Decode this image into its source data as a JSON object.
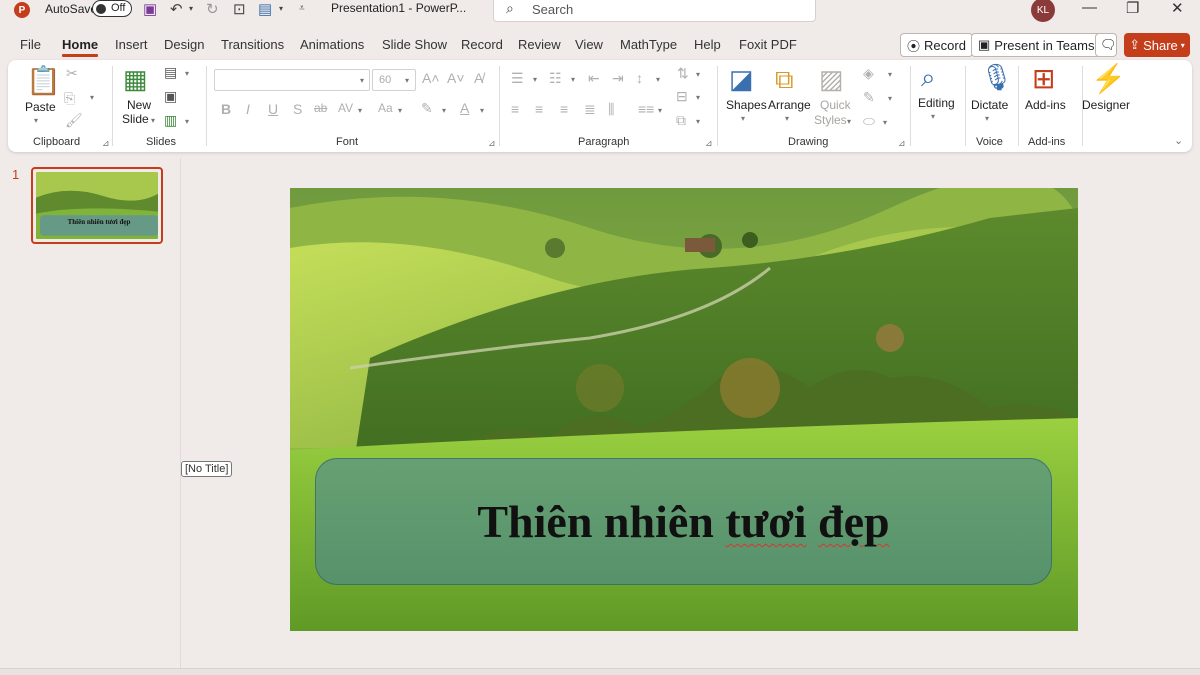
{
  "titlebar": {
    "app_letter": "P",
    "autosave_label": "AutoSave",
    "autosave_state": "Off",
    "doc_title": "Presentation1  -  PowerP...",
    "search_placeholder": "Search",
    "avatar_initials": "KL"
  },
  "menu": {
    "tabs": [
      "File",
      "Home",
      "Insert",
      "Design",
      "Transitions",
      "Animations",
      "Slide Show",
      "Record",
      "Review",
      "View",
      "MathType",
      "Help",
      "Foxit PDF"
    ],
    "active_tab": "Home",
    "record_label": "Record",
    "present_label": "Present in Teams",
    "share_label": "Share"
  },
  "ribbon": {
    "clipboard": {
      "paste_label": "Paste",
      "group_label": "Clipboard"
    },
    "slides": {
      "new_slide_label_1": "New",
      "new_slide_label_2": "Slide",
      "group_label": "Slides"
    },
    "font": {
      "font_name_value": "",
      "font_size_value": "60",
      "group_label": "Font"
    },
    "paragraph": {
      "group_label": "Paragraph"
    },
    "drawing": {
      "shapes_label": "Shapes",
      "arrange_label": "Arrange",
      "quick_styles_1": "Quick",
      "quick_styles_2": "Styles",
      "group_label": "Drawing"
    },
    "editing": {
      "label": "Editing"
    },
    "voice": {
      "dictate_label": "Dictate",
      "group_label": "Voice"
    },
    "addins": {
      "label": "Add-ins",
      "group_label": "Add-ins"
    },
    "designer": {
      "label": "Designer"
    }
  },
  "thumbnails": [
    {
      "number": "1",
      "title": "Thiên nhiên tươi đẹp"
    }
  ],
  "placeholder_tag": "[No Title]",
  "slide": {
    "title_word_1": "Thiên",
    "title_word_2": "nhiên",
    "title_word_3": "tươi",
    "title_word_4": "đẹp"
  },
  "colors": {
    "accent": "#c43e1c",
    "background": "#f0ebe8"
  }
}
